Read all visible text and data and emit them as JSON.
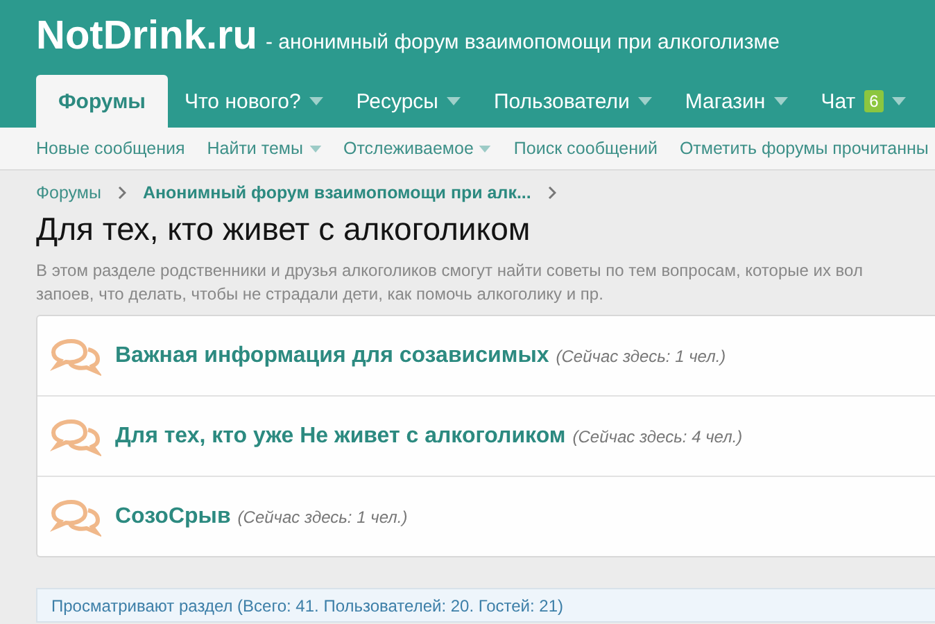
{
  "header": {
    "logo": "NotDrink.ru",
    "tagline": "- анонимный форум взаимопомощи при алкоголизме"
  },
  "tabs": [
    {
      "label": "Форумы",
      "selected": true,
      "dropdown": false
    },
    {
      "label": "Что нового?",
      "selected": false,
      "dropdown": true
    },
    {
      "label": "Ресурсы",
      "selected": false,
      "dropdown": true
    },
    {
      "label": "Пользователи",
      "selected": false,
      "dropdown": true
    },
    {
      "label": "Магазин",
      "selected": false,
      "dropdown": true
    },
    {
      "label": "Чат",
      "selected": false,
      "dropdown": true,
      "badge": "6"
    }
  ],
  "subnav": [
    {
      "label": "Новые сообщения",
      "dropdown": false
    },
    {
      "label": "Найти темы",
      "dropdown": true
    },
    {
      "label": "Отслеживаемое",
      "dropdown": true
    },
    {
      "label": "Поиск сообщений",
      "dropdown": false
    },
    {
      "label": "Отметить форумы прочитанны",
      "dropdown": false
    }
  ],
  "breadcrumbs": [
    {
      "label": "Форумы",
      "current": false
    },
    {
      "label": "Анонимный форум взаимопомощи при алк...",
      "current": true
    }
  ],
  "title": "Для тех, кто живет с алкоголиком",
  "description_lines": [
    "В этом разделе родственники и друзья алкоголиков смогут найти советы по тем вопросам, которые их вол",
    "запоев, что делать, чтобы не страдали дети, как помочь алкоголику и пр."
  ],
  "forums": [
    {
      "name": "Важная информация для созависимых",
      "viewers": "(Сейчас здесь: 1 чел.)"
    },
    {
      "name": "Для тех, кто уже Не живет с алкоголиком",
      "viewers": "(Сейчас здесь: 4 чел.)"
    },
    {
      "name": "СозоСрыв",
      "viewers": "(Сейчас здесь: 1 чел.)"
    }
  ],
  "viewing": "Просматривают раздел (Всего: 41. Пользователей: 20. Гостей: 21)"
}
